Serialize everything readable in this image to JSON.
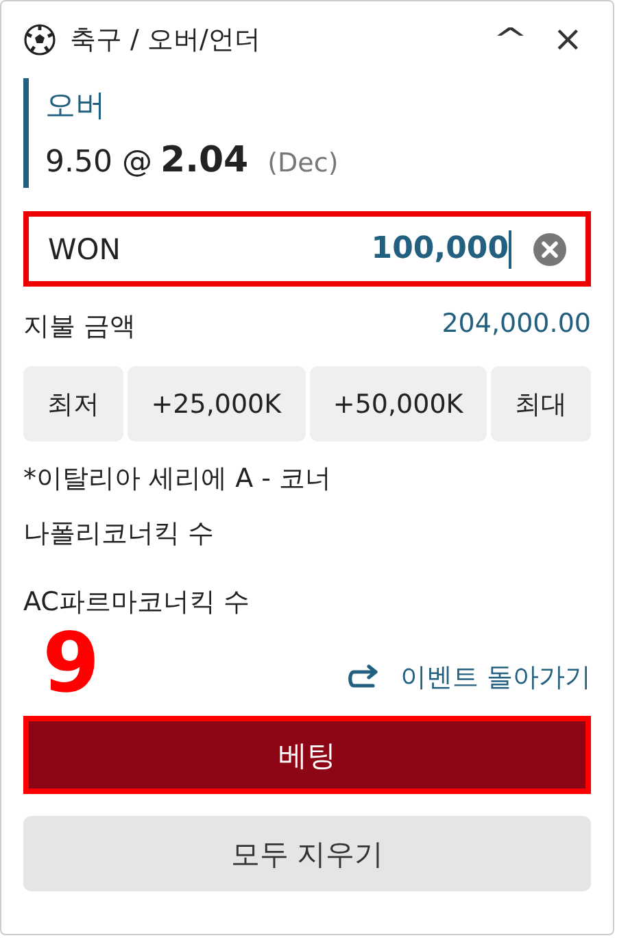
{
  "header": {
    "title": "축구 / 오버/언더",
    "collapse_icon": "^",
    "close_icon": "×"
  },
  "selection": {
    "name": "오버",
    "line": "9.50 @",
    "odds": "2.04",
    "format": "(Dec)"
  },
  "stake": {
    "currency": "WON",
    "value": "100,000",
    "highlighted": true
  },
  "payout": {
    "label": "지불 금액",
    "amount": "204,000.00"
  },
  "quick_stakes": [
    "최저",
    "+25,000K",
    "+50,000K",
    "최대"
  ],
  "market_lines": [
    "*이탈리아 세리에 A - 코너",
    "나폴리코너킥 수",
    "AC파르마코너킥 수"
  ],
  "step_number": "9",
  "back_link": "이벤트 돌아가기",
  "bet_button": {
    "label": "베팅",
    "highlighted": true
  },
  "clear_button": {
    "label": "모두 지우기"
  }
}
